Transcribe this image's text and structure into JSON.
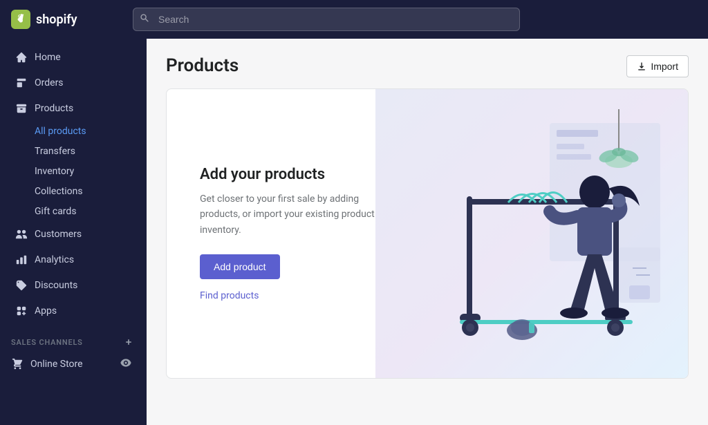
{
  "app": {
    "name": "shopify",
    "logo_text": "shopify",
    "logo_icon": "🛍"
  },
  "topnav": {
    "search_placeholder": "Search"
  },
  "sidebar": {
    "nav_items": [
      {
        "id": "home",
        "label": "Home",
        "icon": "home"
      },
      {
        "id": "orders",
        "label": "Orders",
        "icon": "orders"
      },
      {
        "id": "products",
        "label": "Products",
        "icon": "products"
      }
    ],
    "products_sub": [
      {
        "id": "all-products",
        "label": "All products",
        "active": true
      },
      {
        "id": "transfers",
        "label": "Transfers",
        "active": false
      },
      {
        "id": "inventory",
        "label": "Inventory",
        "active": false
      },
      {
        "id": "collections",
        "label": "Collections",
        "active": false
      },
      {
        "id": "gift-cards",
        "label": "Gift cards",
        "active": false
      }
    ],
    "other_items": [
      {
        "id": "customers",
        "label": "Customers",
        "icon": "customers"
      },
      {
        "id": "analytics",
        "label": "Analytics",
        "icon": "analytics"
      },
      {
        "id": "discounts",
        "label": "Discounts",
        "icon": "discounts"
      },
      {
        "id": "apps",
        "label": "Apps",
        "icon": "apps"
      }
    ],
    "sales_channels_label": "SALES CHANNELS",
    "online_store_label": "Online Store"
  },
  "main": {
    "page_title": "Products",
    "import_button_label": "Import",
    "empty_state": {
      "title": "Add your products",
      "description": "Get closer to your first sale by adding products, or import your existing product inventory.",
      "add_button_label": "Add product",
      "find_link_label": "Find products"
    }
  }
}
